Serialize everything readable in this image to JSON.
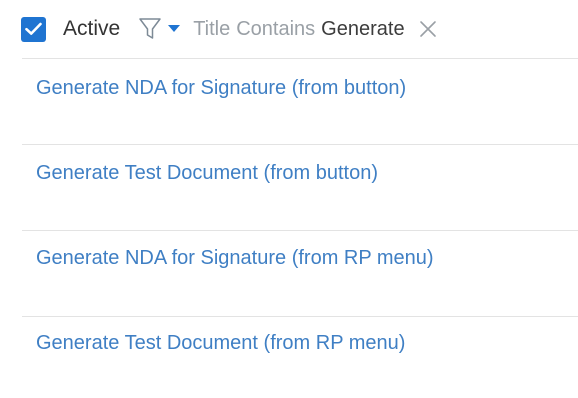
{
  "filter": {
    "active_checked": true,
    "active_label": "Active",
    "field": "Title",
    "operator": "Contains",
    "value": "Generate",
    "accent_color": "#1f74d1",
    "icons": [
      "check-icon",
      "filter-icon",
      "chevron-down-icon",
      "close-icon"
    ]
  },
  "items": [
    {
      "label": "Generate NDA for Signature (from button)"
    },
    {
      "label": "Generate Test Document (from button)"
    },
    {
      "label": "Generate NDA for Signature (from RP menu)"
    },
    {
      "label": "Generate Test Document (from RP menu)"
    }
  ],
  "colors": {
    "link": "#3f7fc4",
    "separator": "#e3e3e3"
  }
}
